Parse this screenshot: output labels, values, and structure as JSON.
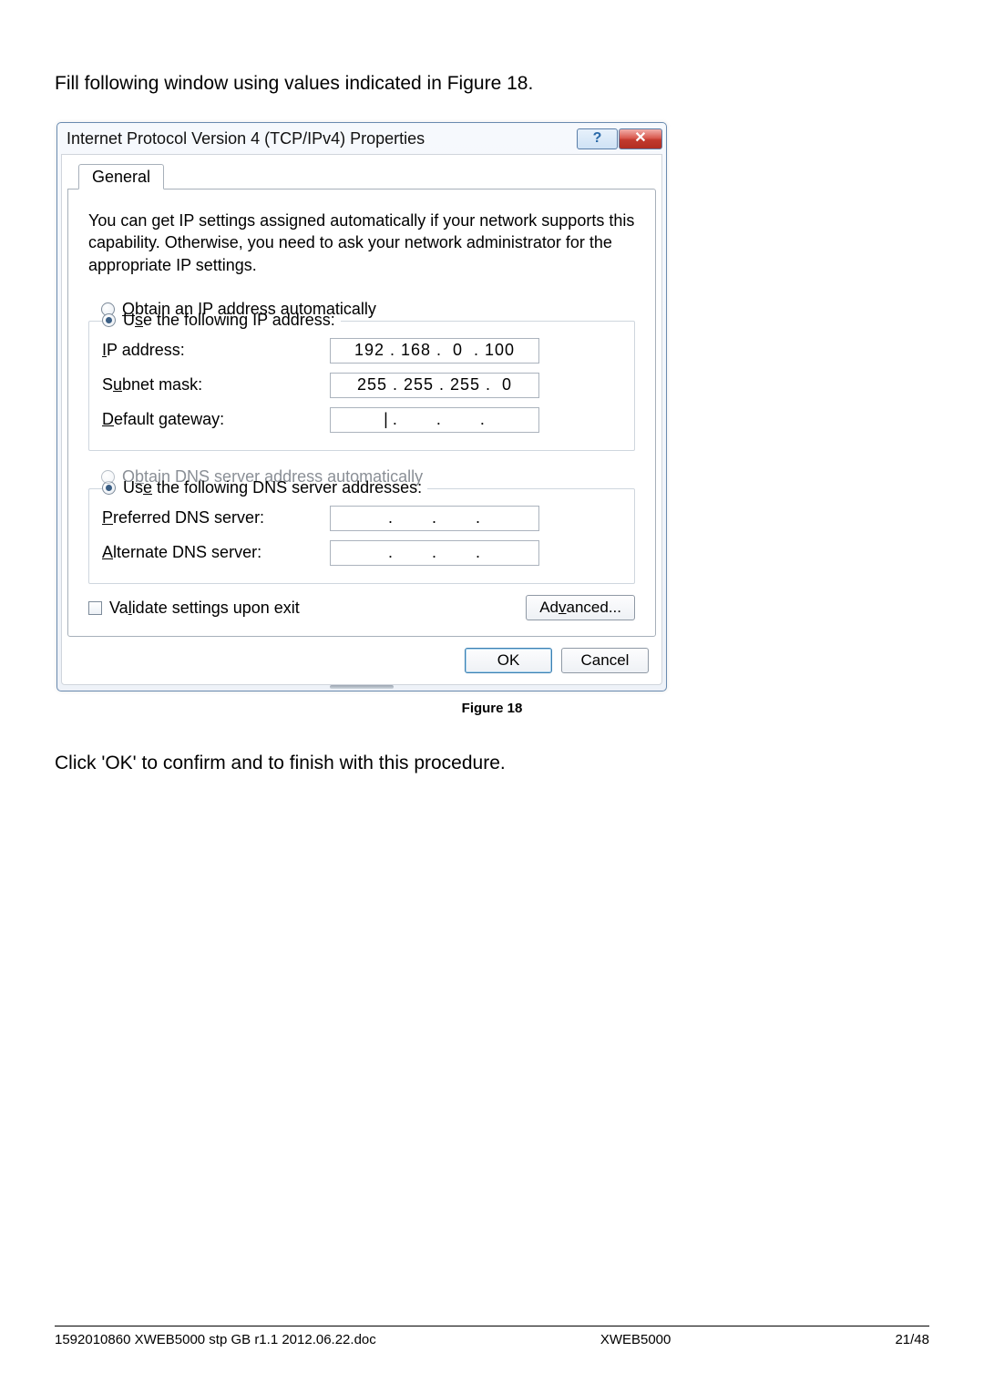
{
  "text": {
    "intro": "Fill following window using values indicated in Figure 18.",
    "caption": "Figure 18",
    "outro": "Click 'OK' to confirm and to finish with this procedure."
  },
  "dialog": {
    "title": "Internet Protocol Version 4 (TCP/IPv4) Properties",
    "help_glyph": "?",
    "close_glyph": "✕",
    "tab": "General",
    "description": "You can get IP settings assigned automatically if your network supports this capability. Otherwise, you need to ask your network administrator for the appropriate IP settings.",
    "ip": {
      "radio_auto": "btain an IP address automatically",
      "radio_auto_u": "O",
      "radio_manual_pre": "U",
      "radio_manual_u": "s",
      "radio_manual_post": "e the following IP address:",
      "label_ip_u": "I",
      "label_ip": "P address:",
      "label_subnet_pre": "S",
      "label_subnet_u": "u",
      "label_subnet_post": "bnet mask:",
      "label_gw_u": "D",
      "label_gw": "efault gateway:",
      "val_ip": "192 . 168 .  0  . 100",
      "val_subnet": "255 . 255 . 255 .  0",
      "val_gw": ".       .       ."
    },
    "dns": {
      "radio_auto_pre": "O",
      "radio_auto_u": "b",
      "radio_auto_post": "tain DNS server address automatically",
      "radio_manual_pre": "Us",
      "radio_manual_u": "e",
      "radio_manual_post": " the following DNS server addresses:",
      "label_pref_u": "P",
      "label_pref": "referred DNS server:",
      "label_alt_u": "A",
      "label_alt": "lternate DNS server:",
      "val_pref": ".       .       .",
      "val_alt": ".       .       ."
    },
    "validate_pre": "Va",
    "validate_u": "l",
    "validate_post": "idate settings upon exit",
    "advanced_pre": "Ad",
    "advanced_u": "v",
    "advanced_post": "anced...",
    "ok": "OK",
    "cancel": "Cancel"
  },
  "footer": {
    "left": "1592010860 XWEB5000 stp GB r1.1 2012.06.22.doc",
    "center": "XWEB5000",
    "right": "21/48"
  }
}
